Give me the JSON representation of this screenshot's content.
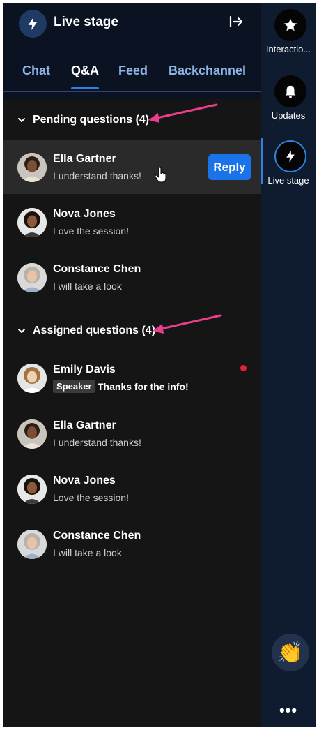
{
  "panel": {
    "title": "Live stage",
    "tabs": [
      {
        "label": "Chat"
      },
      {
        "label": "Q&A"
      },
      {
        "label": "Feed"
      },
      {
        "label": "Backchannel"
      }
    ]
  },
  "pending": {
    "heading": "Pending questions (4)",
    "items": [
      {
        "name": "Ella Gartner",
        "text": "I understand thanks!",
        "action": "Reply"
      },
      {
        "name": "Nova Jones",
        "text": "Love the session!"
      },
      {
        "name": "Constance Chen",
        "text": "I will take a look"
      }
    ]
  },
  "assigned": {
    "heading": "Assigned questions (4)",
    "items": [
      {
        "name": "Emily Davis",
        "badge": "Speaker",
        "text": "Thanks for the info!"
      },
      {
        "name": "Ella Gartner",
        "text": "I understand thanks!"
      },
      {
        "name": "Nova Jones",
        "text": "Love the session!"
      },
      {
        "name": "Constance Chen",
        "text": "I will take a look"
      }
    ]
  },
  "rail": {
    "items": [
      {
        "label": "Interactio...",
        "icon": "star-icon"
      },
      {
        "label": "Updates",
        "icon": "bell-icon"
      },
      {
        "label": "Live stage",
        "icon": "lightning-icon"
      }
    ],
    "clap_icon": "clap-emoji",
    "more": "•••"
  },
  "colors": {
    "accent": "#1a73e8",
    "annotation_arrow": "#e83e8c",
    "unread": "#e5203a"
  }
}
